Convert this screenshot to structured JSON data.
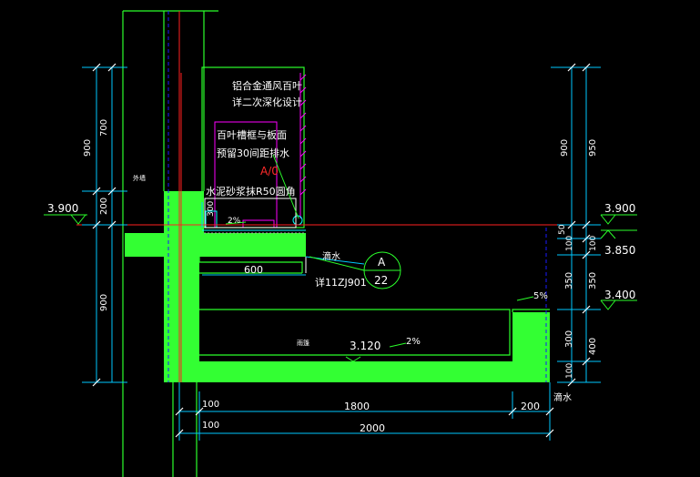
{
  "colors": {
    "background": "#000000",
    "structure_fill": "#33ff33",
    "structure_line": "#2bff2b",
    "dimension_line": "#00c8ff",
    "text": "#ffffff",
    "red_line": "#ff2020",
    "magenta": "#ff00ff",
    "cyan": "#00ffff",
    "dark_blue": "#1a1aff"
  },
  "notes": {
    "louver_line1": "铝合金通风百叶",
    "louver_line2": "详二次深化设计",
    "gap_line1": "百叶槽框与板面",
    "gap_line2": "预留30间距排水",
    "axis_mark": "A/0",
    "mortar": "水泥砂浆抹R50圆角",
    "wall_tag": "外墙",
    "gutter_tag": "雨篷"
  },
  "slopes": {
    "top": "2%",
    "canopy": "2%",
    "edge": "5%"
  },
  "elevations": {
    "left_top": "3.900",
    "right_top": "3.900",
    "right_mid": "3.850",
    "right_low": "3.400",
    "gutter_bottom": "3.120"
  },
  "detail_ref": {
    "drip_label": "滴水",
    "detail_letter": "A",
    "detail_number": "22",
    "standard": "详11ZJ901",
    "drip_edge_label": "滴水"
  },
  "dims": {
    "left_a": "900",
    "left_b": "700",
    "left_c": "200",
    "left_d": "900",
    "right_a": "900",
    "right_b": "950",
    "right_c": "50",
    "right_d": "100",
    "right_e": "100",
    "right_f": "350",
    "right_g": "350",
    "right_h": "300",
    "right_i": "400",
    "right_j": "100",
    "small_300": "300",
    "width_600": "600",
    "bottom_100_a": "100",
    "bottom_1800": "1800",
    "bottom_200": "200",
    "bottom_100_b": "100",
    "bottom_2000": "2000"
  }
}
